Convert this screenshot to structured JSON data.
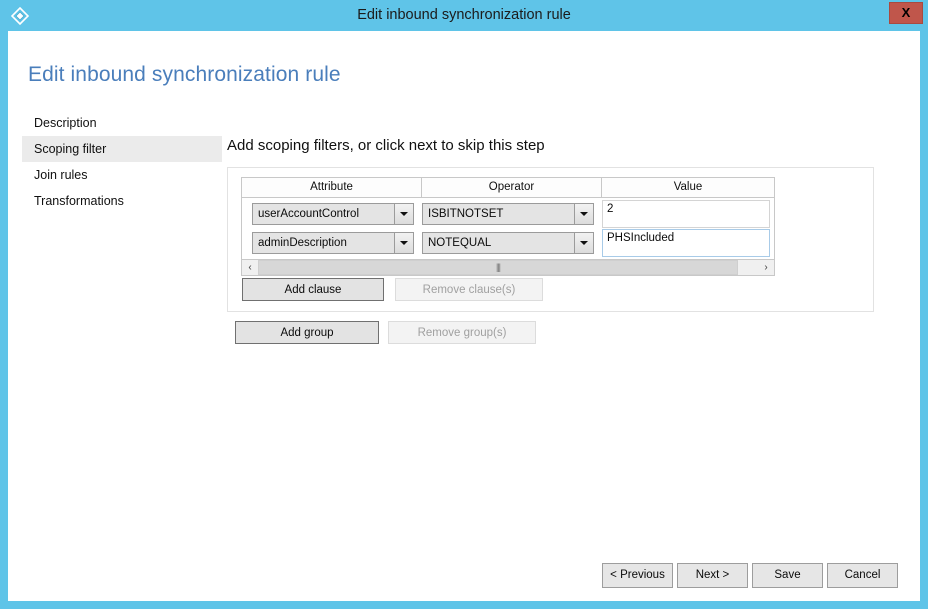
{
  "window": {
    "title": "Edit inbound synchronization rule",
    "icon": "diamond-icon",
    "close_label": "X",
    "titlebar_color": "#5fc4e8",
    "close_color": "#c0564b"
  },
  "page": {
    "heading": "Edit inbound synchronization rule",
    "heading_color": "#4a7ebb"
  },
  "sidebar": {
    "items": [
      {
        "label": "Description",
        "selected": false
      },
      {
        "label": "Scoping filter",
        "selected": true
      },
      {
        "label": "Join rules",
        "selected": false
      },
      {
        "label": "Transformations",
        "selected": false
      }
    ]
  },
  "main": {
    "instruction": "Add scoping filters, or click next to skip this step",
    "table": {
      "columns": [
        "Attribute",
        "Operator",
        "Value"
      ],
      "rows": [
        {
          "attribute": "userAccountControl",
          "operator": "ISBITNOTSET",
          "value": "2",
          "focused": false
        },
        {
          "attribute": "adminDescription",
          "operator": "NOTEQUAL",
          "value": "PHSIncluded",
          "focused": true
        }
      ]
    },
    "scrollbar": {
      "left_arrow": "‹",
      "right_arrow": "›",
      "thumb_grip": "|||"
    },
    "clause_buttons": {
      "add": {
        "label": "Add clause",
        "enabled": true
      },
      "remove": {
        "label": "Remove clause(s)",
        "enabled": false
      }
    },
    "group_buttons": {
      "add": {
        "label": "Add group",
        "enabled": true
      },
      "remove": {
        "label": "Remove group(s)",
        "enabled": false
      }
    }
  },
  "footer": {
    "previous_label": "< Previous",
    "next_label": "Next >",
    "save_label": "Save",
    "cancel_label": "Cancel"
  }
}
